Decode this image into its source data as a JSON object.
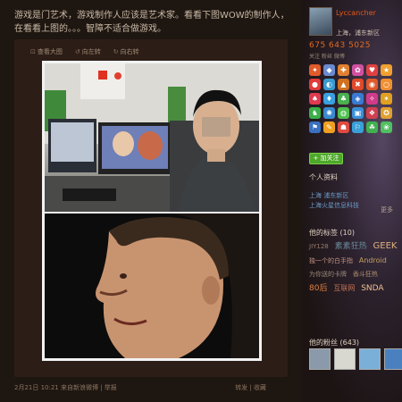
{
  "post": {
    "text": "游戏是门艺术，游戏制作人应该是艺术家。看看下图WOW的制作人，在看看上图的。。。智障不适合做游戏。",
    "toolbar": {
      "view_large": "查看大图",
      "rotate_left": "向左转",
      "rotate_right": "向右转"
    },
    "meta": "2月21日 10:21 来自新浪微博 | 举报",
    "actions": "转发 | 收藏"
  },
  "sidebar": {
    "username": "Lyccancher",
    "location": "上海，浦东新区",
    "stats": "675  643  5025",
    "stats_labels": "关注 粉丝 微博",
    "follow_button": "+ 加关注",
    "personal_info_title": "个人资料",
    "info_lines": [
      "上海 浦东新区",
      "上海火星信息科技"
    ],
    "more": "更多",
    "tags_title": "他的标签 (10)",
    "tags": [
      {
        "text": "JIY128",
        "color": "#9a7a6a"
      },
      {
        "text": "素素狂热",
        "color": "#6a8a9a"
      },
      {
        "text": "GEEK",
        "color": "#e0b080"
      },
      {
        "text": "独一个的白手指",
        "color": "#c09080"
      },
      {
        "text": "Android",
        "color": "#c0a060"
      },
      {
        "text": "为你送的卡牌",
        "color": "#9a8a7a"
      },
      {
        "text": "香斗狂热",
        "color": "#b09070"
      },
      {
        "text": "80后",
        "color": "#e08040"
      },
      {
        "text": "互联网",
        "color": "#c07050"
      },
      {
        "text": "SNDA",
        "color": "#f0c090"
      }
    ],
    "fans_title": "他的粉丝 (643)"
  },
  "colors": {
    "accent": "#e26a20",
    "follow": "#4ea82a"
  }
}
